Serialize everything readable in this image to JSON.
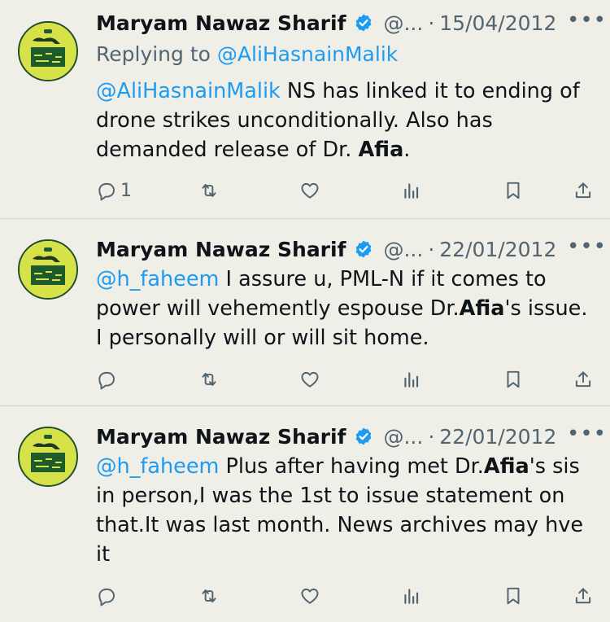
{
  "colors": {
    "background": "#efefe8",
    "link": "#1d9bf0",
    "muted": "#536471",
    "verified": "#1d9bf0"
  },
  "tweets": [
    {
      "author": "Maryam Nawaz Sharif",
      "handle": "@...",
      "separator": "·",
      "date": "15/04/2012",
      "more": "•••",
      "replying_prefix": "Replying to ",
      "replying_to": "@AliHasnainMalik",
      "mention": "@AliHasnainMalik",
      "text_a": " NS has linked it to ending of drone strikes unconditionally. Also has demanded release of Dr. ",
      "bold": "Afia",
      "text_b": ".",
      "reply_count": "1",
      "icons": [
        "reply-icon",
        "retweet-icon",
        "like-icon",
        "views-icon",
        "bookmark-icon",
        "share-icon"
      ]
    },
    {
      "author": "Maryam Nawaz Sharif",
      "handle": "@...",
      "separator": "·",
      "date": "22/01/2012",
      "more": "•••",
      "mention": "@h_faheem",
      "text_a": " I assure u, PML-N if it comes to power will vehemently espouse Dr.",
      "bold": "Afia",
      "text_b": "'s issue. I personally will or will sit home.",
      "reply_count": "",
      "icons": [
        "reply-icon",
        "retweet-icon",
        "like-icon",
        "views-icon",
        "bookmark-icon",
        "share-icon"
      ]
    },
    {
      "author": "Maryam Nawaz Sharif",
      "handle": "@...",
      "separator": "·",
      "date": "22/01/2012",
      "more": "•••",
      "mention": "@h_faheem",
      "text_a": " Plus after having met Dr.",
      "bold": "Afia",
      "text_b": "'s sis in person,I was the 1st to issue statement on that.It was last month. News archives may hve it",
      "reply_count": "",
      "icons": [
        "reply-icon",
        "retweet-icon",
        "like-icon",
        "views-icon",
        "bookmark-icon",
        "share-icon"
      ]
    }
  ]
}
